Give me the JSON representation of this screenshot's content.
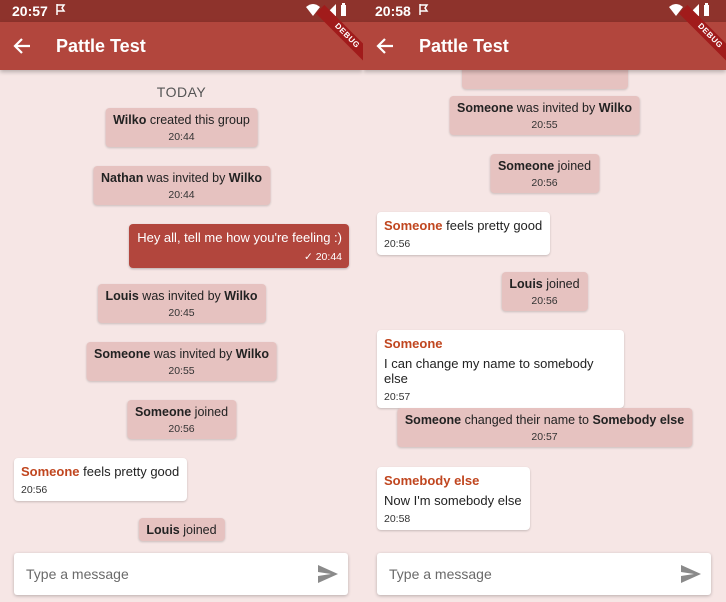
{
  "screens": [
    {
      "status": {
        "time": "20:57"
      },
      "appbar": {
        "title": "Pattle Test",
        "debug_label": "DEBUG"
      },
      "date_separator": "TODAY",
      "events": [
        {
          "name": "Wilko",
          "text": " created this group",
          "time": "20:44"
        },
        {
          "name": "Nathan",
          "text": " was invited by ",
          "name2": "Wilko",
          "time": "20:44"
        },
        {
          "name": "Louis",
          "text": " was invited by ",
          "name2": "Wilko",
          "time": "20:45"
        },
        {
          "name": "Someone",
          "text": " was invited by ",
          "name2": "Wilko",
          "time": "20:55"
        },
        {
          "name": "Someone",
          "text": " joined",
          "time": "20:56"
        },
        {
          "name": "Louis",
          "text": " joined"
        }
      ],
      "outgoing": {
        "text": "Hey all, tell me how you're feeling :)",
        "check": "✓",
        "time": "20:44"
      },
      "incoming": [
        {
          "sender": "Someone",
          "text": " feels pretty good",
          "time": "20:56"
        }
      ],
      "composer": {
        "placeholder": "Type a message"
      }
    },
    {
      "status": {
        "time": "20:58"
      },
      "appbar": {
        "title": "Pattle Test",
        "debug_label": "DEBUG"
      },
      "events": [
        {
          "name": "Someone",
          "text": " was invited by ",
          "name2": "Wilko",
          "time": "20:55"
        },
        {
          "name": "Someone",
          "text": " joined",
          "time": "20:56"
        },
        {
          "name": "Louis",
          "text": " joined",
          "time": "20:56"
        },
        {
          "name": "Someone",
          "text": " changed their name to ",
          "name2": "Somebody else",
          "time": "20:57"
        }
      ],
      "incoming": [
        {
          "sender": "Someone",
          "text": " feels pretty good",
          "time": "20:56"
        },
        {
          "sender": "Someone",
          "text": "I can change my name to somebody else",
          "time": "20:57"
        },
        {
          "sender": "Somebody else",
          "text": "Now I'm somebody else",
          "time": "20:58"
        }
      ],
      "composer": {
        "placeholder": "Type a message"
      }
    }
  ],
  "colors": {
    "status_bar": "#8e332c",
    "app_bar": "#b2463d",
    "background": "#f6e6e5",
    "system_bubble": "#e6c2c0",
    "sender_name": "#c0461f"
  }
}
